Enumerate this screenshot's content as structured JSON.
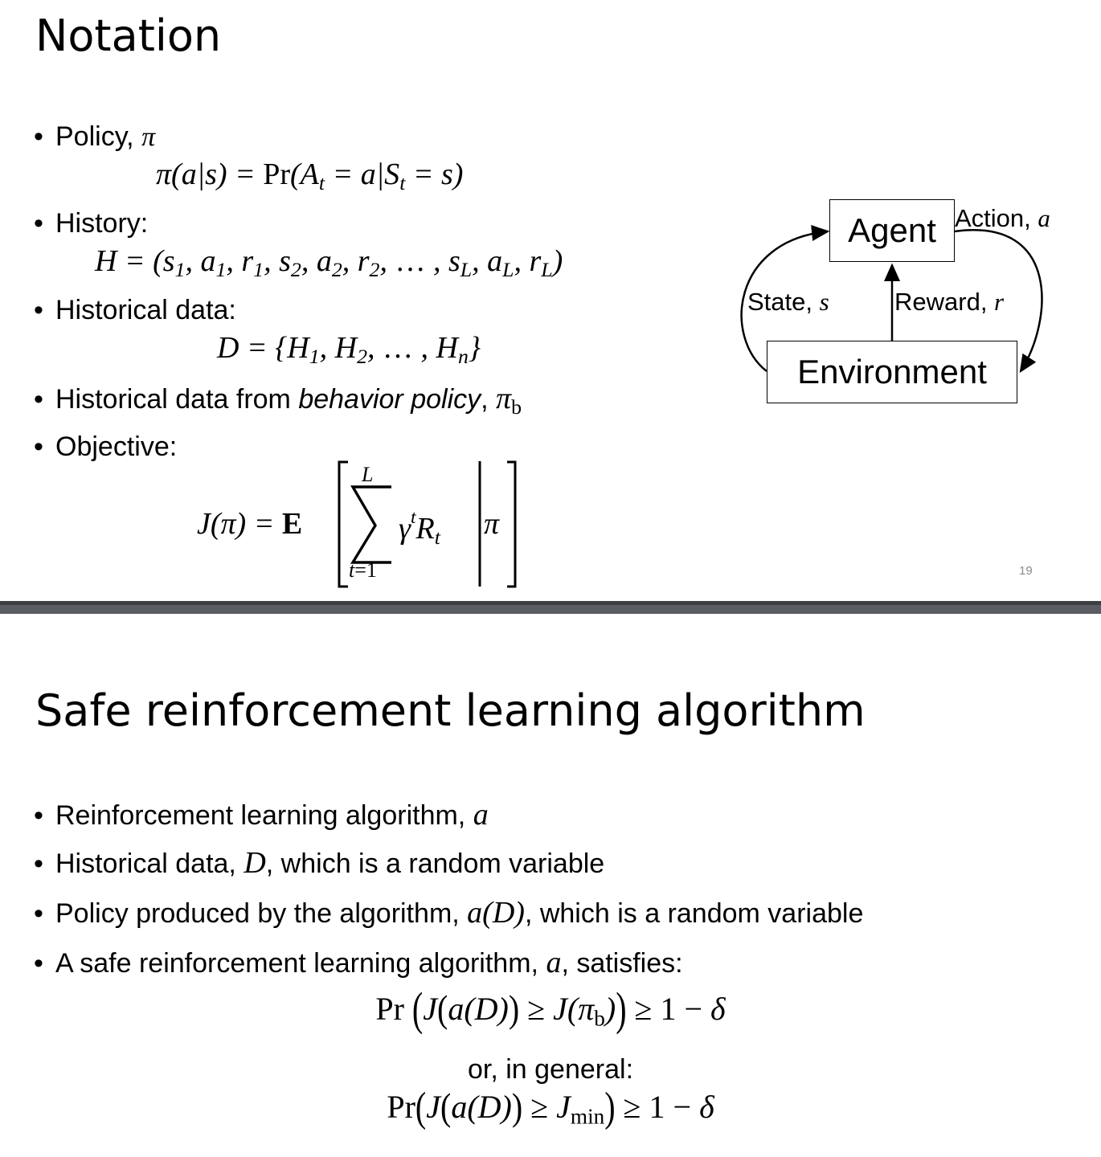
{
  "slide1": {
    "title": "Notation",
    "bullets": {
      "policy": "Policy, ",
      "history": "History:",
      "historical_data": "Historical data:",
      "behavior_prefix": "Historical data from ",
      "behavior_em": "behavior policy",
      "behavior_suffix": ", ",
      "objective": "Objective:"
    },
    "diagram": {
      "agent": "Agent",
      "environment": "Environment",
      "action_label": "Action, ",
      "state_label": "State, ",
      "reward_label": "Reward, "
    },
    "page_number": "19"
  },
  "slide2": {
    "title": "Safe reinforcement learning algorithm",
    "bullets": {
      "b1": "Reinforcement learning algorithm, ",
      "b2_prefix": "Historical data, ",
      "b2_suffix": ", which is a random variable",
      "b3_prefix": "Policy produced by the algorithm, ",
      "b3_suffix": ", which is a random variable",
      "b4_prefix": "A safe reinforcement learning algorithm, ",
      "b4_suffix": ", satisfies:"
    },
    "or_general": "or, in general:"
  }
}
